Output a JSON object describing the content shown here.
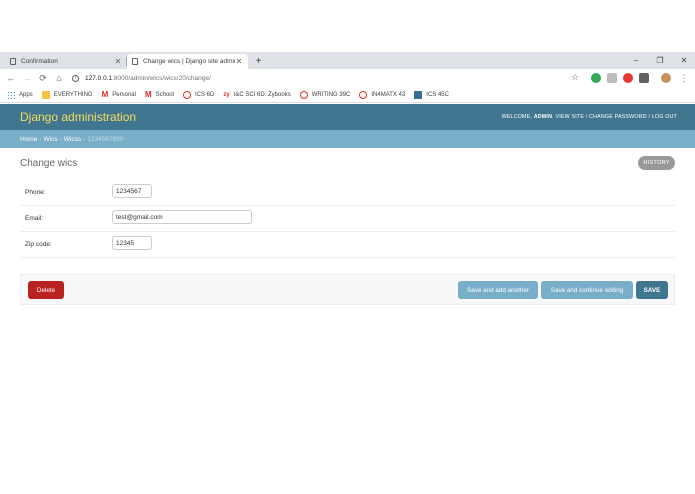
{
  "browser": {
    "tabs": [
      {
        "title": "Confirmation",
        "active": false
      },
      {
        "title": "Change wics | Django site admin",
        "active": true
      }
    ],
    "address": {
      "host": "127.0.0.1",
      "path": ":8000/admin/wics/wics/20/change/"
    },
    "bookmarks": [
      {
        "label": "Apps",
        "icon": "apps-grid-icon"
      },
      {
        "label": "EVERYTHING",
        "icon": "folder-icon"
      },
      {
        "label": "Personal",
        "icon": "gmail-icon"
      },
      {
        "label": "School",
        "icon": "gmail-icon"
      },
      {
        "label": "ICS 6D",
        "icon": "ring-icon"
      },
      {
        "label": "I&C SCI 6D: Zybooks",
        "icon": "zybooks-icon"
      },
      {
        "label": "WRITING 39C",
        "icon": "ring-icon"
      },
      {
        "label": "IN4MATX 43",
        "icon": "ring-icon"
      },
      {
        "label": "ICS 45C",
        "icon": "square-icon"
      }
    ]
  },
  "header": {
    "brand": "Django administration",
    "welcome": "Welcome,",
    "user": "admin",
    "view_site": "View site",
    "change_password": "Change password",
    "log_out": "Log out",
    "sep": "/"
  },
  "breadcrumbs": {
    "home": "Home",
    "app": "Wics",
    "model": "Wicss",
    "object": "1234567890",
    "sep": "›"
  },
  "page": {
    "title": "Change wics",
    "history": "History"
  },
  "form": {
    "phone": {
      "label": "Phone:",
      "value": "1234567"
    },
    "email": {
      "label": "Email:",
      "value": "test@gmail.com"
    },
    "zip": {
      "label": "Zip code:",
      "value": "12345"
    }
  },
  "actions": {
    "delete": "Delete",
    "save_add_another": "Save and add another",
    "save_continue": "Save and continue editing",
    "save": "Save"
  },
  "colors": {
    "header_bg": "#417690",
    "brand": "#f5dd5d",
    "breadcrumbs_bg": "#79aec8",
    "delete": "#ba2121",
    "save": "#417690",
    "secondary_button": "#79aec8"
  }
}
